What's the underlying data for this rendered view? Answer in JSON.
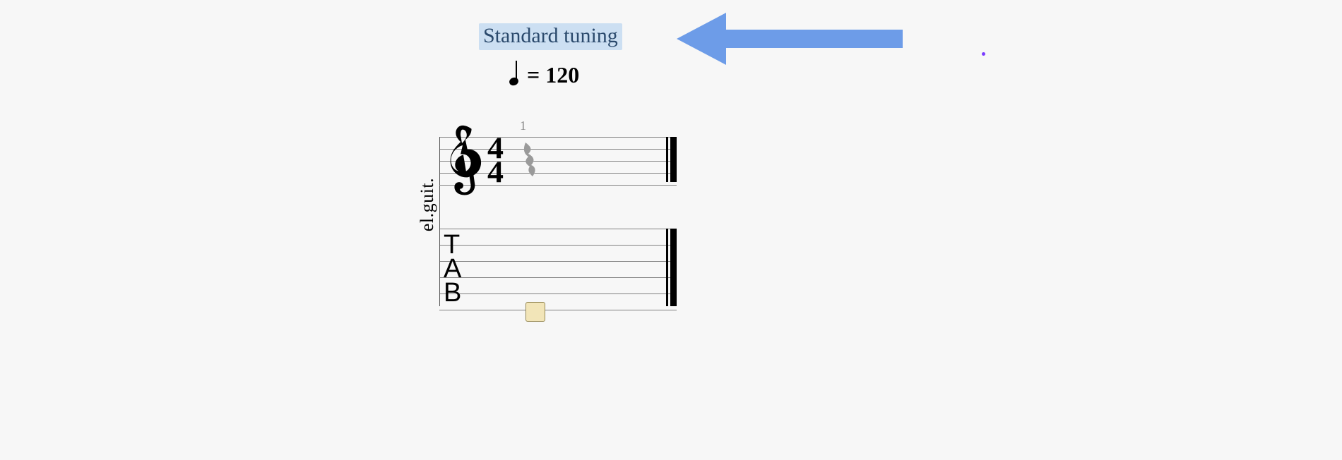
{
  "header": {
    "tuning_label": "Standard tuning",
    "tempo_value": "120",
    "tempo_eq": "="
  },
  "annotation": {
    "arrow_color": "#6d9ce8"
  },
  "score": {
    "instrument_label": "el.guit.",
    "measure_number": "1",
    "time_signature": {
      "numerator": "4",
      "denominator": "4"
    },
    "tab_letters": [
      "T",
      "A",
      "B"
    ]
  }
}
